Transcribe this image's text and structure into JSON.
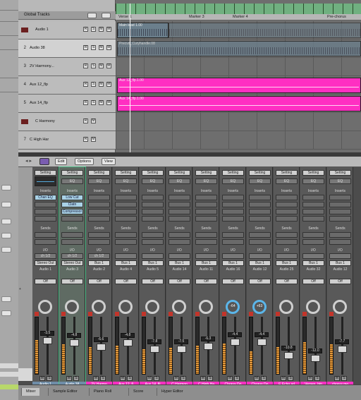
{
  "arrange": {
    "global_tracks_label": "Global Tracks",
    "tracks": [
      {
        "num": "1",
        "name": "Audio 1"
      },
      {
        "num": "2",
        "name": "Audio 38"
      },
      {
        "num": "3",
        "name": "2V Harmony..."
      },
      {
        "num": "4",
        "name": "Aux 12_flp"
      },
      {
        "num": "5",
        "name": "Aux 14_flp"
      },
      {
        "num": "6",
        "name": "C Harmony"
      },
      {
        "num": "7",
        "name": "C High Har"
      }
    ],
    "markers": [
      "Verse 1",
      "Marker 3",
      "Marker 4",
      "Pre-chorus"
    ],
    "regions": {
      "audio1": "Main lead 1.00",
      "audio38": "Precvd_Curyhandle.08",
      "aux12": "Aux 12_flp.1.00",
      "aux14": "Aux 14_flp.1.00"
    },
    "flags": {
      "r": "R",
      "s": "S",
      "m": "M"
    }
  },
  "mixer": {
    "toolbar": {
      "edit": "Edit",
      "options": "Options",
      "view": "View"
    },
    "labels": {
      "setting": "Setting",
      "eq": "EQ",
      "inserts": "Inserts",
      "sends": "Sends",
      "io": "I/O"
    },
    "strips": [
      {
        "setting": "Setting",
        "eq": "EQ",
        "inserts": "Inserts",
        "ins1": "Chan EQ",
        "ins2": "",
        "ins3": "",
        "send": "",
        "in": "ch 1/2",
        "out": "Stereo Out",
        "group": "Audio 1",
        "auto": "Off",
        "knob": "",
        "fader": "-3.5",
        "name": "Audio 1",
        "num": "1",
        "color": "#6f8da8"
      },
      {
        "setting": "Setting",
        "eq": "EQ",
        "inserts": "Inserts",
        "ins1": "Low Cut",
        "ins2": "Clatn",
        "ins3": "Compressor",
        "send": "",
        "in": "ch 1/2",
        "out": "Stereo Out",
        "group": "Audio 3",
        "auto": "Off",
        "knob": "",
        "fader": "-4.8",
        "name": "Audio 38",
        "num": "2",
        "color": "#6f8da8"
      },
      {
        "setting": "Setting",
        "eq": "EQ",
        "inserts": "Inserts",
        "ins1": "",
        "ins2": "",
        "ins3": "",
        "send": "",
        "in": "ch 1/2",
        "out": "Bus 1",
        "group": "Audio 2",
        "auto": "Off",
        "knob": "",
        "fader": "-6.6",
        "name": "2V Harmo",
        "num": "3",
        "color": "#ff2fc2"
      },
      {
        "setting": "Setting",
        "eq": "EQ",
        "inserts": "Inserts",
        "ins1": "",
        "ins2": "",
        "ins3": "",
        "send": "",
        "in": "",
        "out": "Bus 1",
        "group": "Audio 4",
        "auto": "Off",
        "knob": "",
        "fader": "-4.8",
        "name": "Aux 12_fl",
        "num": "4",
        "color": "#ff2fc2"
      },
      {
        "setting": "Setting",
        "eq": "EQ",
        "inserts": "Inserts",
        "ins1": "",
        "ins2": "",
        "ins3": "",
        "send": "",
        "in": "",
        "out": "Bus 1",
        "group": "Audio 5",
        "auto": "Off",
        "knob": "",
        "fader": "-7.8",
        "name": "Aux 14_fli",
        "num": "5",
        "color": "#ff2fc2"
      },
      {
        "setting": "Setting",
        "eq": "EQ",
        "inserts": "Inserts",
        "ins1": "",
        "ins2": "",
        "ins3": "",
        "send": "",
        "in": "",
        "out": "Bus 1",
        "group": "Audio 14",
        "auto": "Off",
        "knob": "",
        "fader": "-7.5",
        "name": "C Harmon",
        "num": "6",
        "color": "#ff2fc2"
      },
      {
        "setting": "Setting",
        "eq": "EQ",
        "inserts": "Inserts",
        "ins1": "",
        "ins2": "",
        "ins3": "",
        "send": "",
        "in": "",
        "out": "Bus 1",
        "group": "Audio 11",
        "auto": "Off",
        "knob": "",
        "fader": "-6.3",
        "name": "C High Ha",
        "num": "7",
        "color": "#ff2fc2"
      },
      {
        "setting": "Setting",
        "eq": "EQ",
        "inserts": "Inserts",
        "ins1": "",
        "ins2": "",
        "ins3": "",
        "send": "",
        "in": "",
        "out": "Bus 1",
        "group": "Audio 16",
        "auto": "Off",
        "knob": "-64",
        "fader": "-4.4",
        "name": "Chorus Do",
        "num": "8",
        "color": "#ff2fc2"
      },
      {
        "setting": "Setting",
        "eq": "EQ",
        "inserts": "Inserts",
        "ins1": "",
        "ins2": "",
        "ins3": "",
        "send": "",
        "in": "",
        "out": "Bus 1",
        "group": "Audio 12",
        "auto": "Off",
        "knob": "+63",
        "fader": "-4.4",
        "name": "Chorus Do",
        "num": "9",
        "color": "#ff2fc2"
      },
      {
        "setting": "Setting",
        "eq": "EQ",
        "inserts": "Inserts",
        "ins1": "",
        "ins2": "",
        "ins3": "",
        "send": "",
        "in": "",
        "out": "Bus 1",
        "group": "Audio 25",
        "auto": "Off",
        "knob": "",
        "fader": "-10.8",
        "name": "E Echo sd",
        "num": "10",
        "color": "#ff2fc2"
      },
      {
        "setting": "Setting",
        "eq": "EQ",
        "inserts": "Inserts",
        "ins1": "",
        "ins2": "",
        "ins3": "",
        "send": "",
        "in": "",
        "out": "Bus 1",
        "group": "Audio 32",
        "auto": "Off",
        "knob": "",
        "fader": "-12.0",
        "name": "Verses_bip",
        "num": "11",
        "color": "#ff2fc2"
      },
      {
        "setting": "Setting",
        "eq": "EQ",
        "inserts": "Inserts",
        "ins1": "",
        "ins2": "",
        "ins3": "",
        "send": "",
        "in": "",
        "out": "Bus 1",
        "group": "Audio 12",
        "auto": "Off",
        "knob": "",
        "fader": "-7.7",
        "name": "chorus mo",
        "num": "12",
        "color": "#ff2fc2"
      }
    ]
  },
  "bottom_tabs": [
    "Mixer",
    "Sample Editor",
    "Piano Roll",
    "Score",
    "Hyper Editor"
  ],
  "colors": {
    "accent_pink": "#ff2fc2",
    "ruler_green": "#70b080",
    "selected_outline": "#4fbf8a"
  }
}
